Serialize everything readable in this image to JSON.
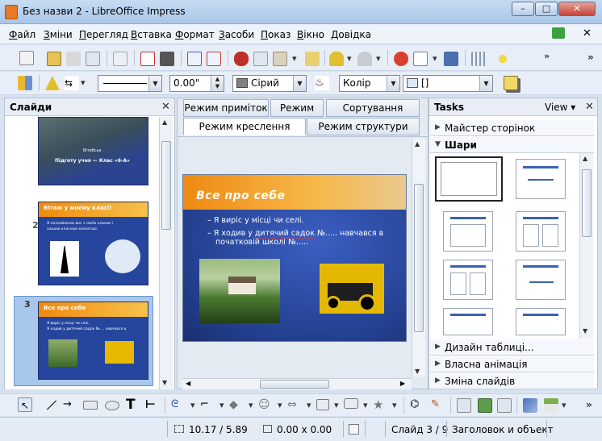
{
  "window": {
    "title": "Без назви 2 - LibreOffice Impress",
    "min": "–",
    "max": "□",
    "close": "✕"
  },
  "menu": [
    {
      "label": "Файл",
      "u": "Ф",
      "rest": "айл"
    },
    {
      "label": "Зміни",
      "u": "З",
      "rest": "міни"
    },
    {
      "label": "Перегляд",
      "u": "П",
      "rest": "ерегляд"
    },
    {
      "label": "Вставка",
      "u": "В",
      "rest": "ставка"
    },
    {
      "label": "Формат",
      "u": "Ф",
      "rest": "ормат"
    },
    {
      "label": "Засоби",
      "u": "З",
      "rest": "асоби"
    },
    {
      "label": "Показ",
      "u": "П",
      "rest": "оказ"
    },
    {
      "label": "Вікно",
      "u": "В",
      "rest": "ікно"
    },
    {
      "label": "Довідка",
      "u": "Д",
      "rest": "овідка"
    }
  ],
  "line_toolbar": {
    "line_width": "0.00\"",
    "line_color": "Сірий",
    "area_style": "Колір",
    "area_value": "[]"
  },
  "slides_pane": {
    "title": "Слайди",
    "close": "✕",
    "slides": [
      {
        "number": "1",
        "caption": "Підготу учня — Клас «6-А»",
        "sub": "Вітебськ"
      },
      {
        "number": "2",
        "title": "Вітаю у моєму класі!",
        "b1": "Я познайомлю вас з своїм класом і",
        "b2": "нашою класною кімнатою."
      },
      {
        "number": "3",
        "title": "Все про себе",
        "b1": "Я виріс у місці чи селі.",
        "b2": "Я ходив у дитячий садок №.... навчався в"
      }
    ]
  },
  "tabs": {
    "row1": [
      "Режим приміток",
      "Режим тез",
      "Сортування слайду"
    ],
    "row2": [
      "Режим креслення",
      "Режим структури"
    ]
  },
  "slide": {
    "title": "Все про себе",
    "bullet1": "Я виріс у місці чи селі.",
    "bullet2_a": "Я ходив у ",
    "bullet2_b": "дитячий садок",
    "bullet2_c": " №..... навчався в",
    "bullet2_line2": "початковій школі №....."
  },
  "tasks": {
    "title": "Tasks",
    "view": "View",
    "close": "✕",
    "sections": [
      "Майстер сторінок",
      "Шари",
      "Дизайн таблиці...",
      "Власна анімація",
      "Зміна слайдів"
    ]
  },
  "status": {
    "position": "10.17 / 5.89",
    "size": "0.00 x 0.00",
    "slide": "Слайд 3 / 9",
    "layout": "Заголовок и объект"
  }
}
